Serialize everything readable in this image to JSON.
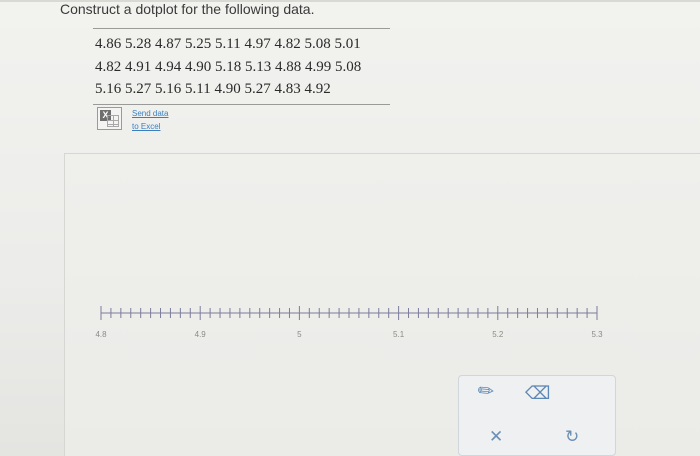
{
  "question": {
    "prompt": "Construct a dotplot for the following data.",
    "data_rows": [
      "4.86 5.28 4.87 5.25 5.11 4.97 4.82 5.08 5.01",
      "4.82 4.91 4.94 4.90 5.18 5.13 4.88 4.99 5.08",
      "5.16 5.27 5.16 5.11 4.90 5.27 4.83 4.92"
    ],
    "excel": {
      "icon": "excel-icon",
      "line1": "Send data",
      "line2": "to Excel"
    }
  },
  "dotplot": {
    "axis_min": 4.8,
    "axis_max": 5.3,
    "minor_step": 0.01,
    "tick_labels": [
      "4.8",
      "4.9",
      "5",
      "5.1",
      "5.2",
      "5.3"
    ],
    "dots": []
  },
  "toolbar": {
    "pencil_icon": "pencil-icon",
    "eraser_icon": "eraser-icon",
    "close_icon": "close-icon",
    "undo_icon": "undo-icon",
    "pencil_glyph": "✎",
    "eraser_glyph": "⌫",
    "close_glyph": "✕",
    "undo_glyph": "↻"
  },
  "colors": {
    "link": "#3a7fc0",
    "tool_accent": "#5c86b4",
    "axis": "#7c7c9c"
  }
}
